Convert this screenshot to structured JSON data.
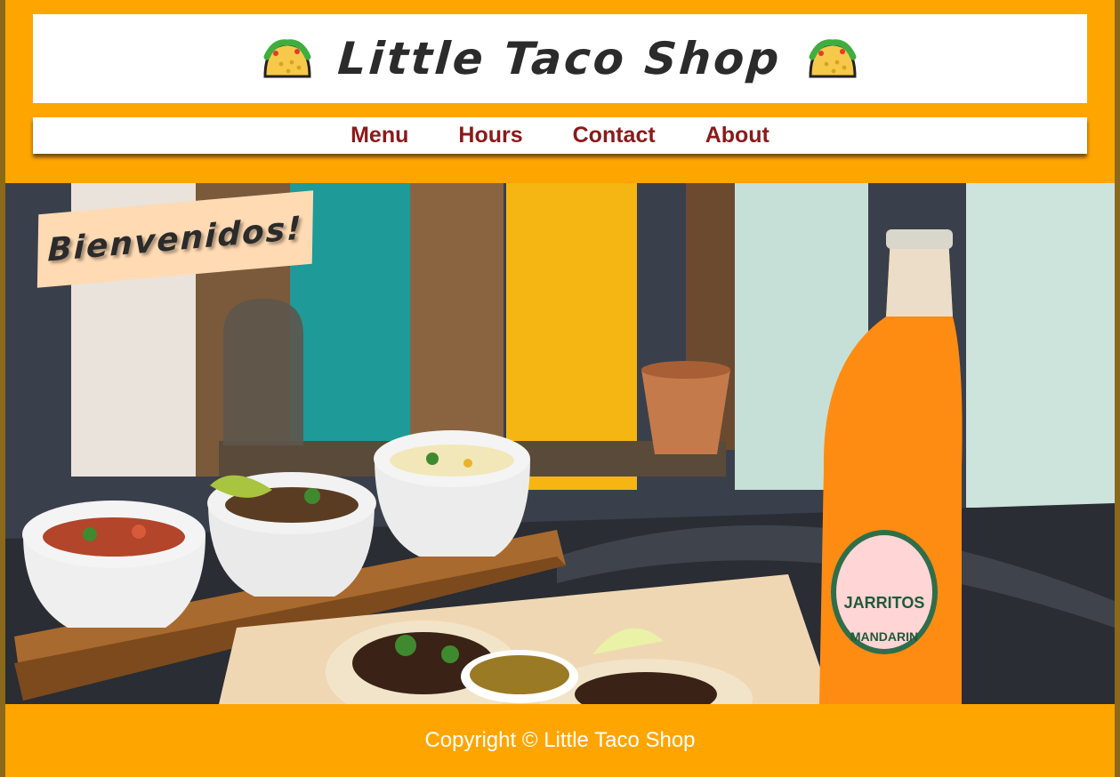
{
  "header": {
    "title": "Little Taco Shop",
    "left_icon": "taco-icon",
    "right_icon": "taco-icon"
  },
  "nav": {
    "items": [
      {
        "label": "Menu"
      },
      {
        "label": "Hours"
      },
      {
        "label": "Contact"
      },
      {
        "label": "About"
      }
    ]
  },
  "hero": {
    "banner_text": "Bienvenidos!",
    "bottle_brand": "JARRITOS",
    "bottle_flavor": "MANDARIN"
  },
  "footer": {
    "copyright": "Copyright © Little Taco Shop"
  },
  "colors": {
    "page_background": "#FFA500",
    "nav_link": "#8B1A1A",
    "banner_background": "#FFDAB3",
    "title_text": "#2B2B2B"
  }
}
